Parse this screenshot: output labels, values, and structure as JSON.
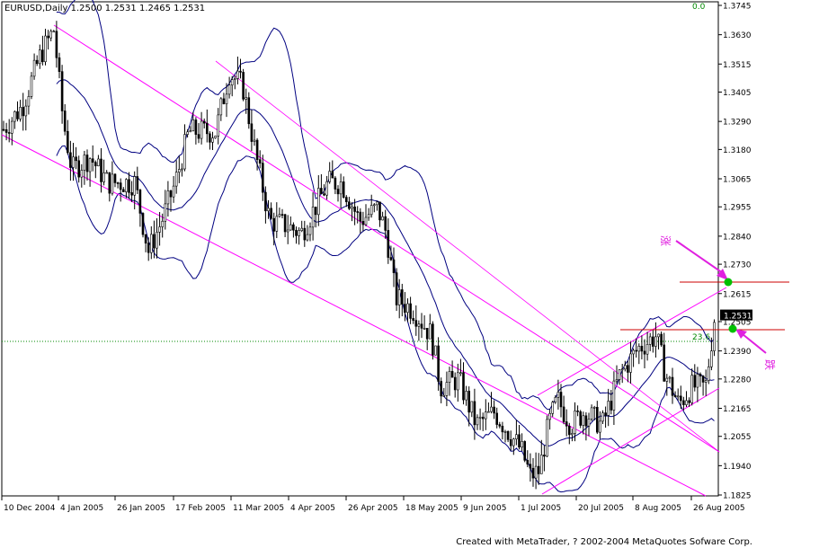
{
  "chart_data": {
    "type": "candlestick",
    "header": "EURUSD,Daily  1.2500 1.2531 1.2465 1.2531",
    "symbol": "EURUSD",
    "timeframe": "Daily",
    "last_price_label": "1.2531",
    "y_ticks": [
      "1.3745",
      "1.3630",
      "1.3515",
      "1.3405",
      "1.3290",
      "1.3180",
      "1.3065",
      "1.2955",
      "1.2840",
      "1.2730",
      "1.2615",
      "1.2505",
      "1.2390",
      "1.2280",
      "1.2165",
      "1.2055",
      "1.1940",
      "1.1825"
    ],
    "ylim": [
      1.1825,
      1.3745
    ],
    "x_ticks": [
      "10 Dec 2004",
      "4 Jan 2005",
      "26 Jan 2005",
      "17 Feb 2005",
      "11 Mar 2005",
      "4 Apr 2005",
      "26 Apr 2005",
      "18 May 2005",
      "9 Jun 2005",
      "1 Jul 2005",
      "20 Jul 2005",
      "8 Aug 2005",
      "26 Aug 2005"
    ],
    "fib_labels": {
      "top": "0.0",
      "level": "23.6"
    },
    "annotations": {
      "upper": "涨",
      "lower": "跌"
    },
    "indicators": [
      "Bollinger Bands",
      "Price channel (down)",
      "Price channel (up)"
    ],
    "colors": {
      "candle": "#000000",
      "bands": "#000080",
      "channel": "#FF00FF",
      "marker": "#00C000",
      "level_line": "#CC0000",
      "arrow": "#E020E0",
      "price_box": "#000000"
    }
  },
  "footer": "Created with MetaTrader, ? 2002-2004 MetaQuotes Sofware Corp."
}
